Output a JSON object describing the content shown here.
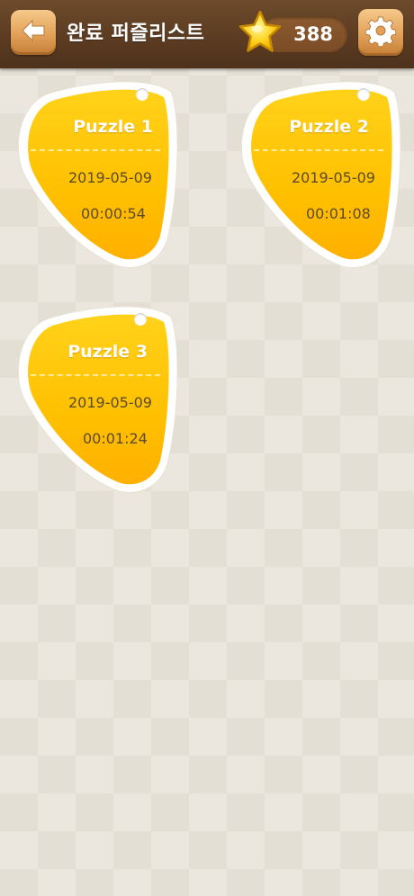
{
  "header": {
    "title": "완료 퍼즐리스트",
    "score": "388",
    "back_icon": "back-arrow-icon",
    "star_icon": "star-icon",
    "settings_icon": "gear-icon"
  },
  "colors": {
    "header_brown": "#5c3c22",
    "button_orange": "#e2a15a",
    "tag_yellow": "#ffc400",
    "tag_text": "#5a4a2a"
  },
  "puzzles": [
    {
      "name": "Puzzle 1",
      "date": "2019-05-09",
      "time": "00:00:54"
    },
    {
      "name": "Puzzle 2",
      "date": "2019-05-09",
      "time": "00:01:08"
    },
    {
      "name": "Puzzle 3",
      "date": "2019-05-09",
      "time": "00:01:24"
    }
  ]
}
